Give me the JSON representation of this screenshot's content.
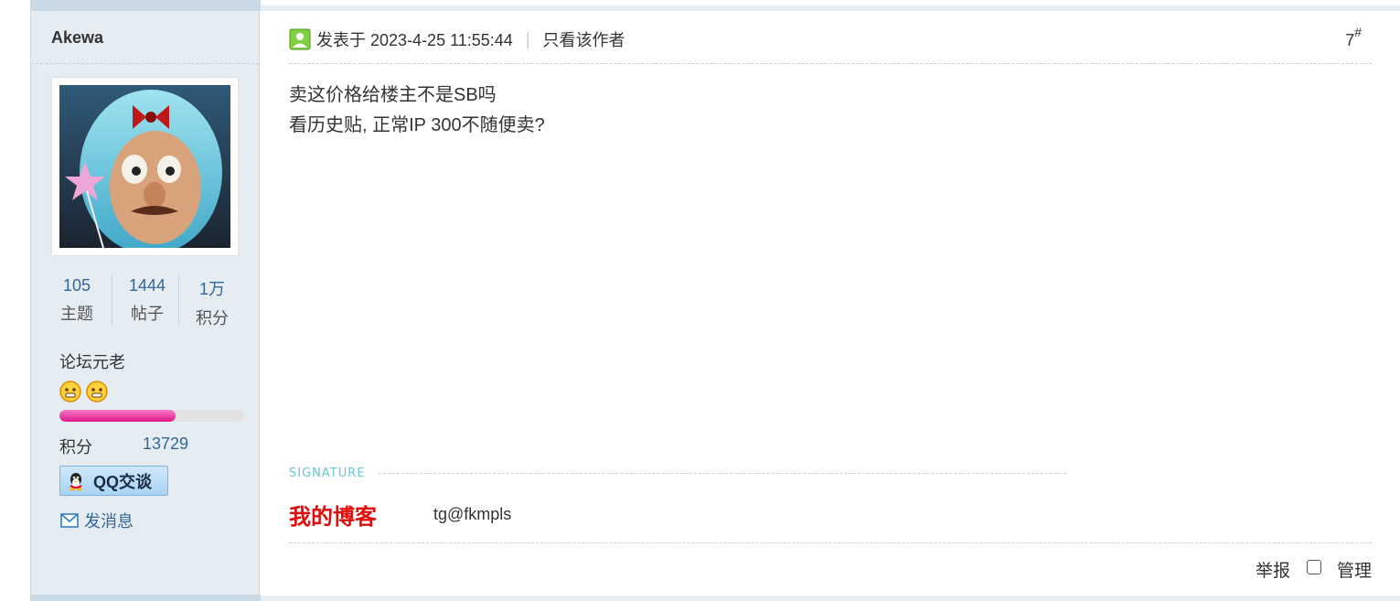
{
  "author": {
    "username": "Akewa",
    "stats": [
      {
        "value": "105",
        "label": "主题"
      },
      {
        "value": "1444",
        "label": "帖子"
      },
      {
        "value": "1万",
        "label": "积分"
      }
    ],
    "rank": "论坛元老",
    "rank_icons": [
      "smiley-icon",
      "smiley-icon"
    ],
    "progress_fraction": 0.63,
    "score_label": "积分",
    "score_value": "13729",
    "qq_button_label": "QQ交谈",
    "message_label": "发消息"
  },
  "post": {
    "posted_prefix": "发表于",
    "posted_at": "2023-4-25 11:55:44",
    "separator": "|",
    "author_only_label": "只看该作者",
    "floor_number": "7",
    "floor_suffix": "#",
    "body_lines": [
      "卖这价格给楼主不是SB吗",
      "看历史贴, 正常IP 300不随便卖?"
    ],
    "signature_heading": "SIGNATURE",
    "signature_blog": "我的博客",
    "signature_contact": "tg@fkmpls",
    "report_label": "举报",
    "manage_label": "管理"
  },
  "colors": {
    "sidebar_bg": "#e5edf2",
    "link_blue": "#336699",
    "blog_red": "#e10d0d",
    "progress_pink": "#e01888",
    "signature_teal": "#6cc4d8"
  }
}
